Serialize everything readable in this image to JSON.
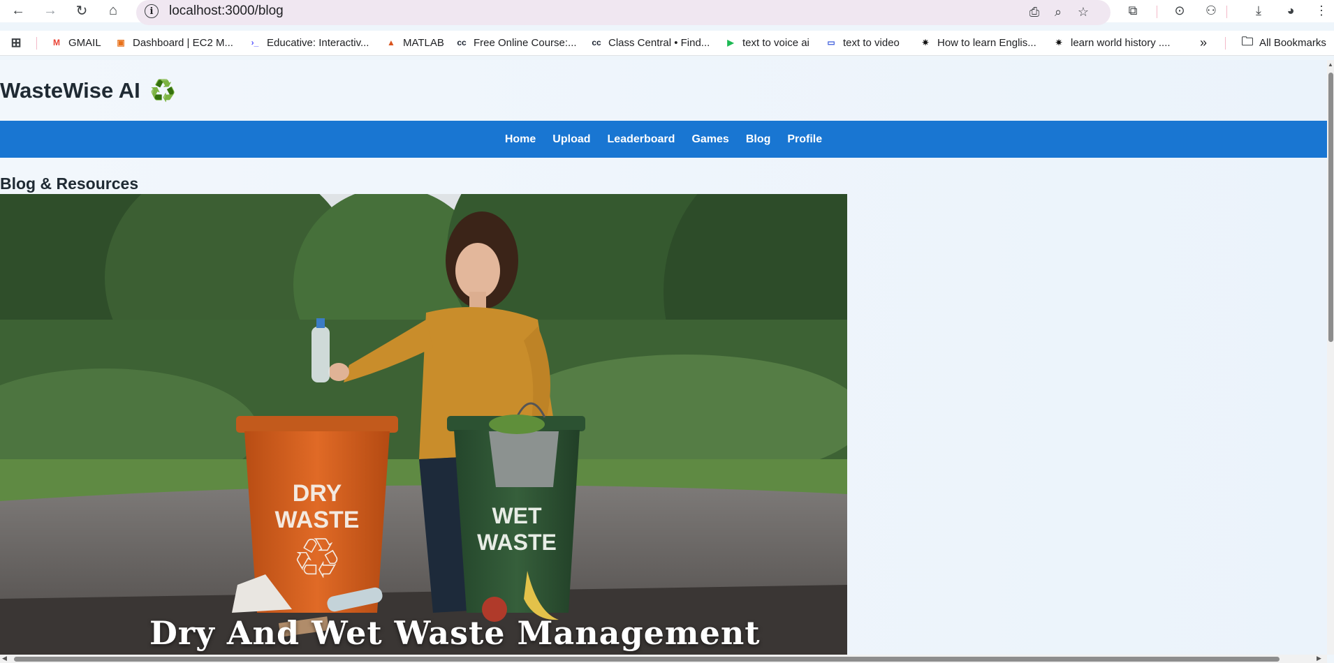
{
  "browser": {
    "url": "localhost:3000/blog",
    "bookmarks": [
      {
        "label": "GMAIL",
        "icon": "gmail-icon",
        "glyph": "M",
        "color": "#ea4335"
      },
      {
        "label": "Dashboard | EC2 M...",
        "icon": "aws-icon",
        "glyph": "▣",
        "color": "#e8711a"
      },
      {
        "label": "Educative: Interactiv...",
        "icon": "educative-icon",
        "glyph": "›_",
        "color": "#5553ff"
      },
      {
        "label": "MATLAB",
        "icon": "matlab-icon",
        "glyph": "▲",
        "color": "#d9541e"
      },
      {
        "label": "Free Online Course:...",
        "icon": "classcentral-icon",
        "glyph": "cc",
        "color": "#1b2330"
      },
      {
        "label": "Class Central • Find...",
        "icon": "classcentral-icon",
        "glyph": "cc",
        "color": "#1b2330"
      },
      {
        "label": "text to voice ai",
        "icon": "play-icon",
        "glyph": "▶",
        "color": "#1db954"
      },
      {
        "label": "text to video",
        "icon": "video-icon",
        "glyph": "▭",
        "color": "#3b5bdb"
      },
      {
        "label": "How to learn Englis...",
        "icon": "asterisk-icon",
        "glyph": "✷",
        "color": "#111"
      },
      {
        "label": "learn world history ....",
        "icon": "asterisk-icon",
        "glyph": "✷",
        "color": "#111"
      }
    ],
    "all_bookmarks_label": "All Bookmarks"
  },
  "app": {
    "title": "WasteWise AI",
    "title_icon": "♻️",
    "nav": [
      "Home",
      "Upload",
      "Leaderboard",
      "Games",
      "Blog",
      "Profile"
    ],
    "section_title": "Blog & Resources",
    "hero": {
      "caption": "Dry And Wet Waste Management",
      "bin_dry_text": [
        "DRY",
        "WASTE"
      ],
      "bin_wet_text": [
        "WET",
        "WASTE"
      ],
      "colors": {
        "dry_bin": "#d4601f",
        "wet_bin": "#2f5a35",
        "sweater": "#c98d2b",
        "foliage": "#3f6b35"
      }
    }
  }
}
